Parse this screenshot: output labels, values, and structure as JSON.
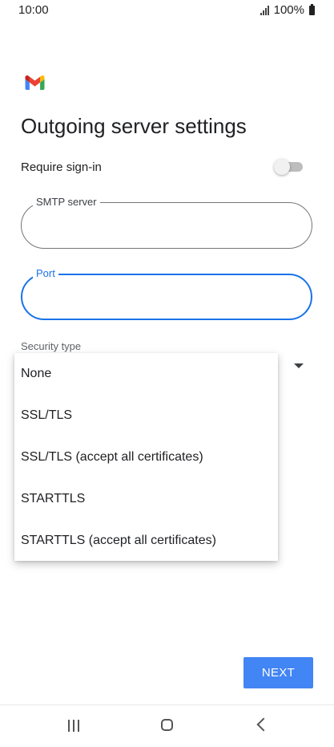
{
  "status_bar": {
    "time": "10:00",
    "battery": "100%",
    "signal_icon": "signal-icon",
    "battery_icon": "battery-icon"
  },
  "app": {
    "logo_icon": "gmail-logo-icon",
    "title": "Outgoing server settings"
  },
  "form": {
    "require_signin": {
      "label": "Require sign-in",
      "enabled": false
    },
    "smtp_server": {
      "label": "SMTP server",
      "value": ""
    },
    "port": {
      "label": "Port",
      "value": "",
      "focused": true
    },
    "security_type": {
      "label": "Security type"
    }
  },
  "security_menu": {
    "options": [
      "None",
      "SSL/TLS",
      "SSL/TLS (accept all certificates)",
      "STARTTLS",
      "STARTTLS (accept all certificates)"
    ]
  },
  "actions": {
    "next_label": "NEXT"
  },
  "colors": {
    "accent": "#1a73e8",
    "button": "#4285f4"
  },
  "nav_bar": {
    "icons": [
      "recent-apps-icon",
      "home-icon",
      "back-icon"
    ]
  }
}
